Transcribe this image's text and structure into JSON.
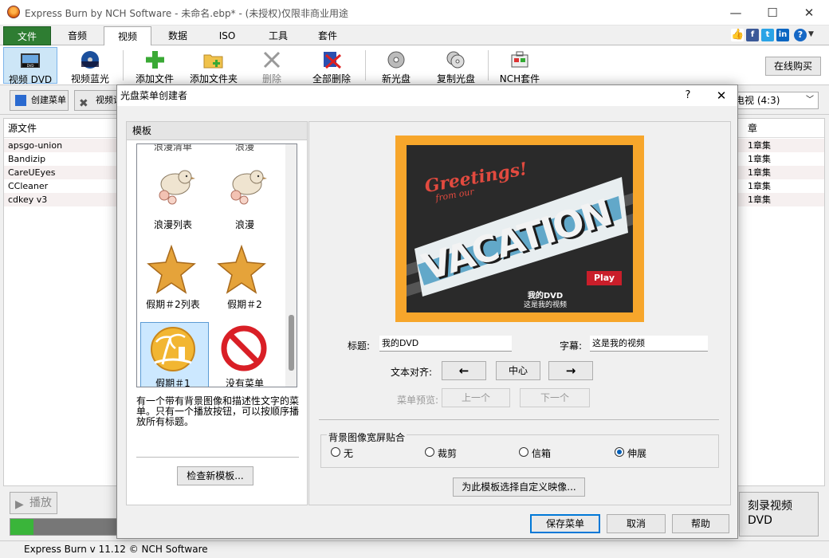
{
  "window": {
    "title": "Express Burn by NCH Software - 未命名.ebp* - (未授权)仅限非商业用途"
  },
  "menu_tabs": [
    "文件",
    "音频",
    "视频",
    "数据",
    "ISO",
    "工具",
    "套件"
  ],
  "social": [
    "f",
    "t",
    "in"
  ],
  "toolbar": {
    "items": [
      "视频 DVD",
      "视频蓝光",
      "添加文件",
      "添加文件夹",
      "删除",
      "全部删除",
      "新光盘",
      "复制光盘",
      "NCH套件"
    ],
    "buy": "在线购买"
  },
  "strip": {
    "create_menu": "创建菜单",
    "video_settings": "视频设",
    "tv_system": "电视 (4:3)"
  },
  "file_list": {
    "header": "源文件",
    "chapter_header": "章",
    "rows": [
      {
        "name": "apsgo-union",
        "chapters": "1章集"
      },
      {
        "name": "Bandizip",
        "chapters": "1章集"
      },
      {
        "name": "CareUEyes",
        "chapters": "1章集"
      },
      {
        "name": "CCleaner",
        "chapters": "1章集"
      },
      {
        "name": "cdkey v3",
        "chapters": "1章集"
      }
    ]
  },
  "bottom": {
    "play": "播放",
    "burn": "刻录视频 DVD",
    "progress": 0.21,
    "status": "Express Burn v 11.12 © NCH Software"
  },
  "dialog": {
    "title": "光盘菜单创建者",
    "help": "?",
    "close": "✕",
    "templates": {
      "header": "模板",
      "items": [
        {
          "label": "浪漫列表",
          "icon": "bird-icon"
        },
        {
          "label": "浪漫",
          "icon": "bird-icon"
        },
        {
          "label": "假期＃2列表",
          "icon": "starfish-icon"
        },
        {
          "label": "假期＃2",
          "icon": "starfish-icon"
        },
        {
          "label": "假期＃1",
          "icon": "palm-icon",
          "selected": true
        },
        {
          "label": "没有菜单",
          "icon": "no-icon"
        }
      ],
      "partial_top": [
        "浪漫清单",
        "浪漫"
      ],
      "description": "有一个带有背景图像和描述性文字的菜单。只有一个播放按钮，可以按顺序播放所有标题。",
      "check_button": "检查新模板..."
    },
    "preview": {
      "greeting": "Greetings!",
      "from": "from our",
      "vacation": "VACATION",
      "play": "Play",
      "disc_title": "我的DVD",
      "subtitle": "这是我的视频"
    },
    "fields": {
      "title_label": "标题:",
      "title_value": "我的DVD",
      "subtitle_label": "字幕:",
      "subtitle_value": "这是我的视频",
      "align_label": "文本对齐:",
      "align_left": "←",
      "align_center": "中心",
      "align_right": "→",
      "preview_label": "菜单预览:",
      "prev": "上一个",
      "next": "下一个"
    },
    "bg_fit": {
      "label": "背景图像宽屏贴合",
      "options": [
        "无",
        "裁剪",
        "信箱",
        "伸展"
      ],
      "selected": "伸展"
    },
    "custom_image_button": "为此模板选择自定义映像...",
    "save": "保存菜单",
    "cancel": "取消",
    "help_button": "帮助"
  }
}
